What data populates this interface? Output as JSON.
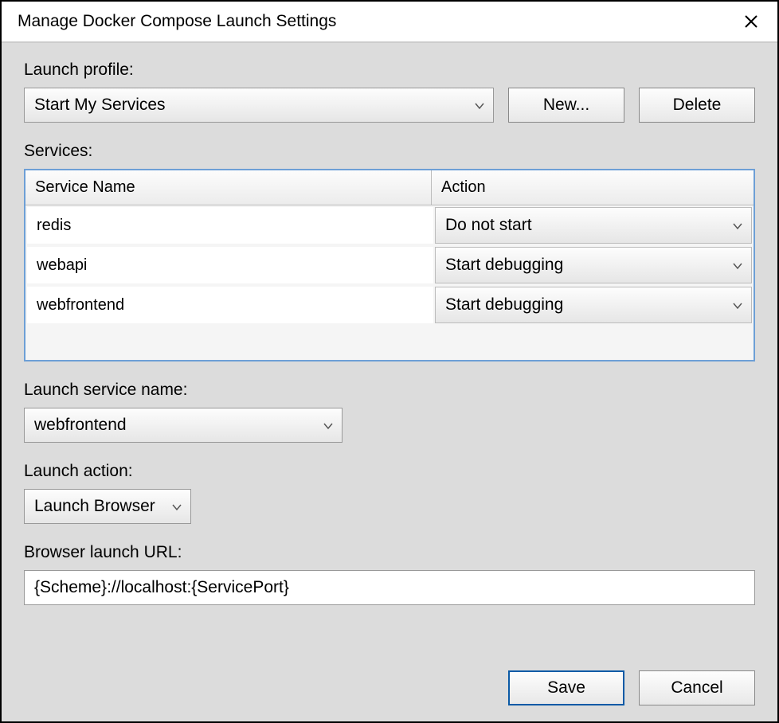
{
  "window": {
    "title": "Manage Docker Compose Launch Settings"
  },
  "labels": {
    "launch_profile": "Launch profile:",
    "services": "Services:",
    "service_name_header": "Service Name",
    "action_header": "Action",
    "launch_service_name": "Launch service name:",
    "launch_action": "Launch action:",
    "browser_launch_url": "Browser launch URL:"
  },
  "launch_profile": {
    "selected": "Start My Services"
  },
  "buttons": {
    "new": "New...",
    "delete": "Delete",
    "save": "Save",
    "cancel": "Cancel"
  },
  "services_rows": [
    {
      "name": "redis",
      "action": "Do not start"
    },
    {
      "name": "webapi",
      "action": "Start debugging"
    },
    {
      "name": "webfrontend",
      "action": "Start debugging"
    }
  ],
  "launch_service_name": {
    "selected": "webfrontend"
  },
  "launch_action": {
    "selected": "Launch Browser"
  },
  "browser_launch_url": {
    "value": "{Scheme}://localhost:{ServicePort}"
  }
}
